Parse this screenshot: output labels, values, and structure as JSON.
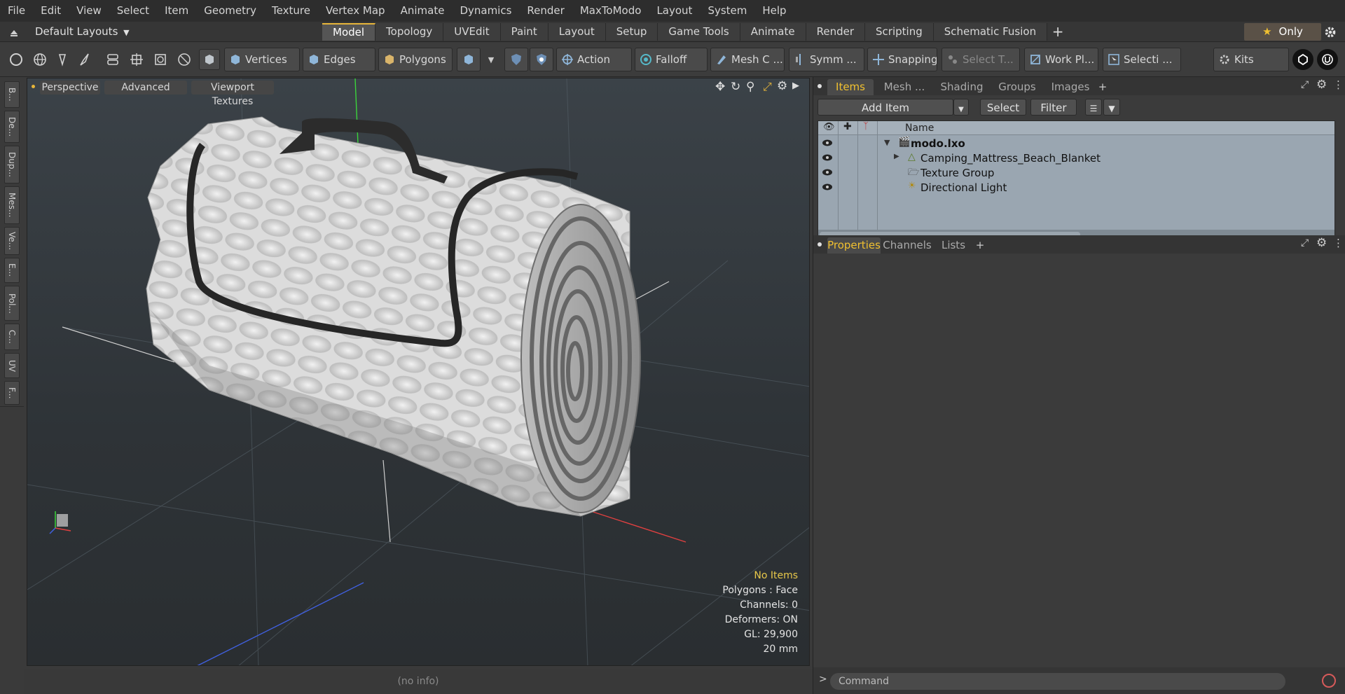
{
  "menu": [
    "File",
    "Edit",
    "View",
    "Select",
    "Item",
    "Geometry",
    "Texture",
    "Vertex Map",
    "Animate",
    "Dynamics",
    "Render",
    "MaxToModo",
    "Layout",
    "System",
    "Help"
  ],
  "layout_bar": {
    "layout_name": "Default Layouts",
    "tabs": [
      "Model",
      "Topology",
      "UVEdit",
      "Paint",
      "Layout",
      "Setup",
      "Game Tools",
      "Animate",
      "Render",
      "Scripting",
      "Schematic Fusion"
    ],
    "active_tab": "Model",
    "plus": "+",
    "only_label": "Only"
  },
  "toolbar": {
    "vertices": "Vertices",
    "edges": "Edges",
    "polygons": "Polygons",
    "action": "Action",
    "falloff": "Falloff",
    "mesh": "Mesh C ...",
    "symm": "Symm ...",
    "snapping": "Snapping",
    "select_t": "Select T...",
    "workplane": "Work Pl...",
    "selection": "Selecti ...",
    "kits": "Kits"
  },
  "left_tabs": [
    "B...",
    "De...",
    "Dup...",
    "Mes...",
    "Ve...",
    "E...",
    "Pol...",
    "C...",
    "UV",
    "F..."
  ],
  "viewport": {
    "perspective": "Perspective",
    "advanced": "Advanced",
    "viewport_textures": "Viewport Textures",
    "stats": {
      "items": "No Items",
      "polygons": "Polygons : Face",
      "channels": "Channels: 0",
      "deformers": "Deformers: ON",
      "gl": "GL: 29,900",
      "unit": "20 mm"
    }
  },
  "status": "(no info)",
  "items_panel": {
    "tabs": [
      "Items",
      "Mesh ...",
      "Shading",
      "Groups",
      "Images"
    ],
    "active_tab": "Items",
    "plus": "+",
    "add_item": "Add Item",
    "select": "Select",
    "filter": "Filter",
    "name_header": "Name",
    "rows": [
      {
        "label": "modo.lxo",
        "bold": true
      },
      {
        "label": "Camping_Mattress_Beach_Blanket",
        "bold": false
      },
      {
        "label": "Texture Group",
        "bold": false
      },
      {
        "label": "Directional Light",
        "bold": false
      }
    ]
  },
  "properties_panel": {
    "tabs": [
      "Properties",
      "Channels",
      "Lists"
    ],
    "active_tab": "Properties",
    "plus": "+"
  },
  "command": {
    "prompt": ">",
    "placeholder": "Command"
  },
  "colors": {
    "accent": "#e6b53a",
    "active_tab_text": "#f0c030",
    "stats_highlight": "#e8c84a"
  }
}
